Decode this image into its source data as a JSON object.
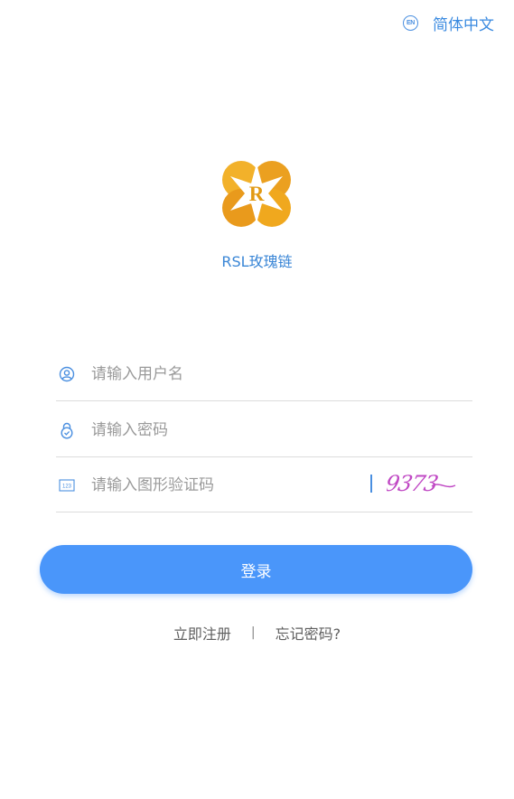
{
  "header": {
    "lang_badge": "EN",
    "lang_label": "简体中文"
  },
  "brand": {
    "logo_letter": "R",
    "app_name": "RSL玫瑰链"
  },
  "form": {
    "username_placeholder": "请输入用户名",
    "password_placeholder": "请输入密码",
    "captcha_placeholder": "请输入图形验证码",
    "captcha_text": "9373",
    "login_label": "登录"
  },
  "links": {
    "register": "立即注册",
    "separator": "|",
    "forgot": "忘记密码?"
  },
  "colors": {
    "accent": "#4a96fa",
    "brand_text": "#3a86d6",
    "logo_gold": "#f0a81e"
  }
}
